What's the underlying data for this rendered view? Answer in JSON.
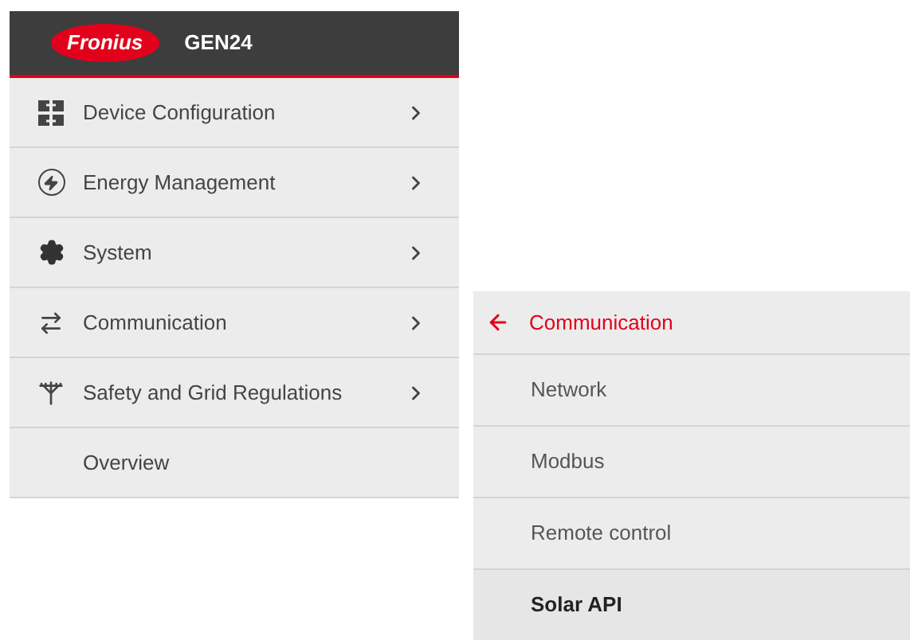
{
  "header": {
    "logo": "Fronius",
    "title": "GEN24"
  },
  "main_menu": [
    {
      "label": "Device Configuration",
      "kind": "submenu"
    },
    {
      "label": "Energy Management",
      "kind": "submenu"
    },
    {
      "label": "System",
      "kind": "submenu"
    },
    {
      "label": "Communication",
      "kind": "submenu"
    },
    {
      "label": "Safety and Grid Regulations",
      "kind": "submenu"
    },
    {
      "label": "Overview",
      "kind": "link"
    }
  ],
  "submenu": {
    "title": "Communication",
    "items": [
      {
        "label": "Network",
        "selected": false
      },
      {
        "label": "Modbus",
        "selected": false
      },
      {
        "label": "Remote control",
        "selected": false
      },
      {
        "label": "Solar API",
        "selected": true
      }
    ]
  }
}
